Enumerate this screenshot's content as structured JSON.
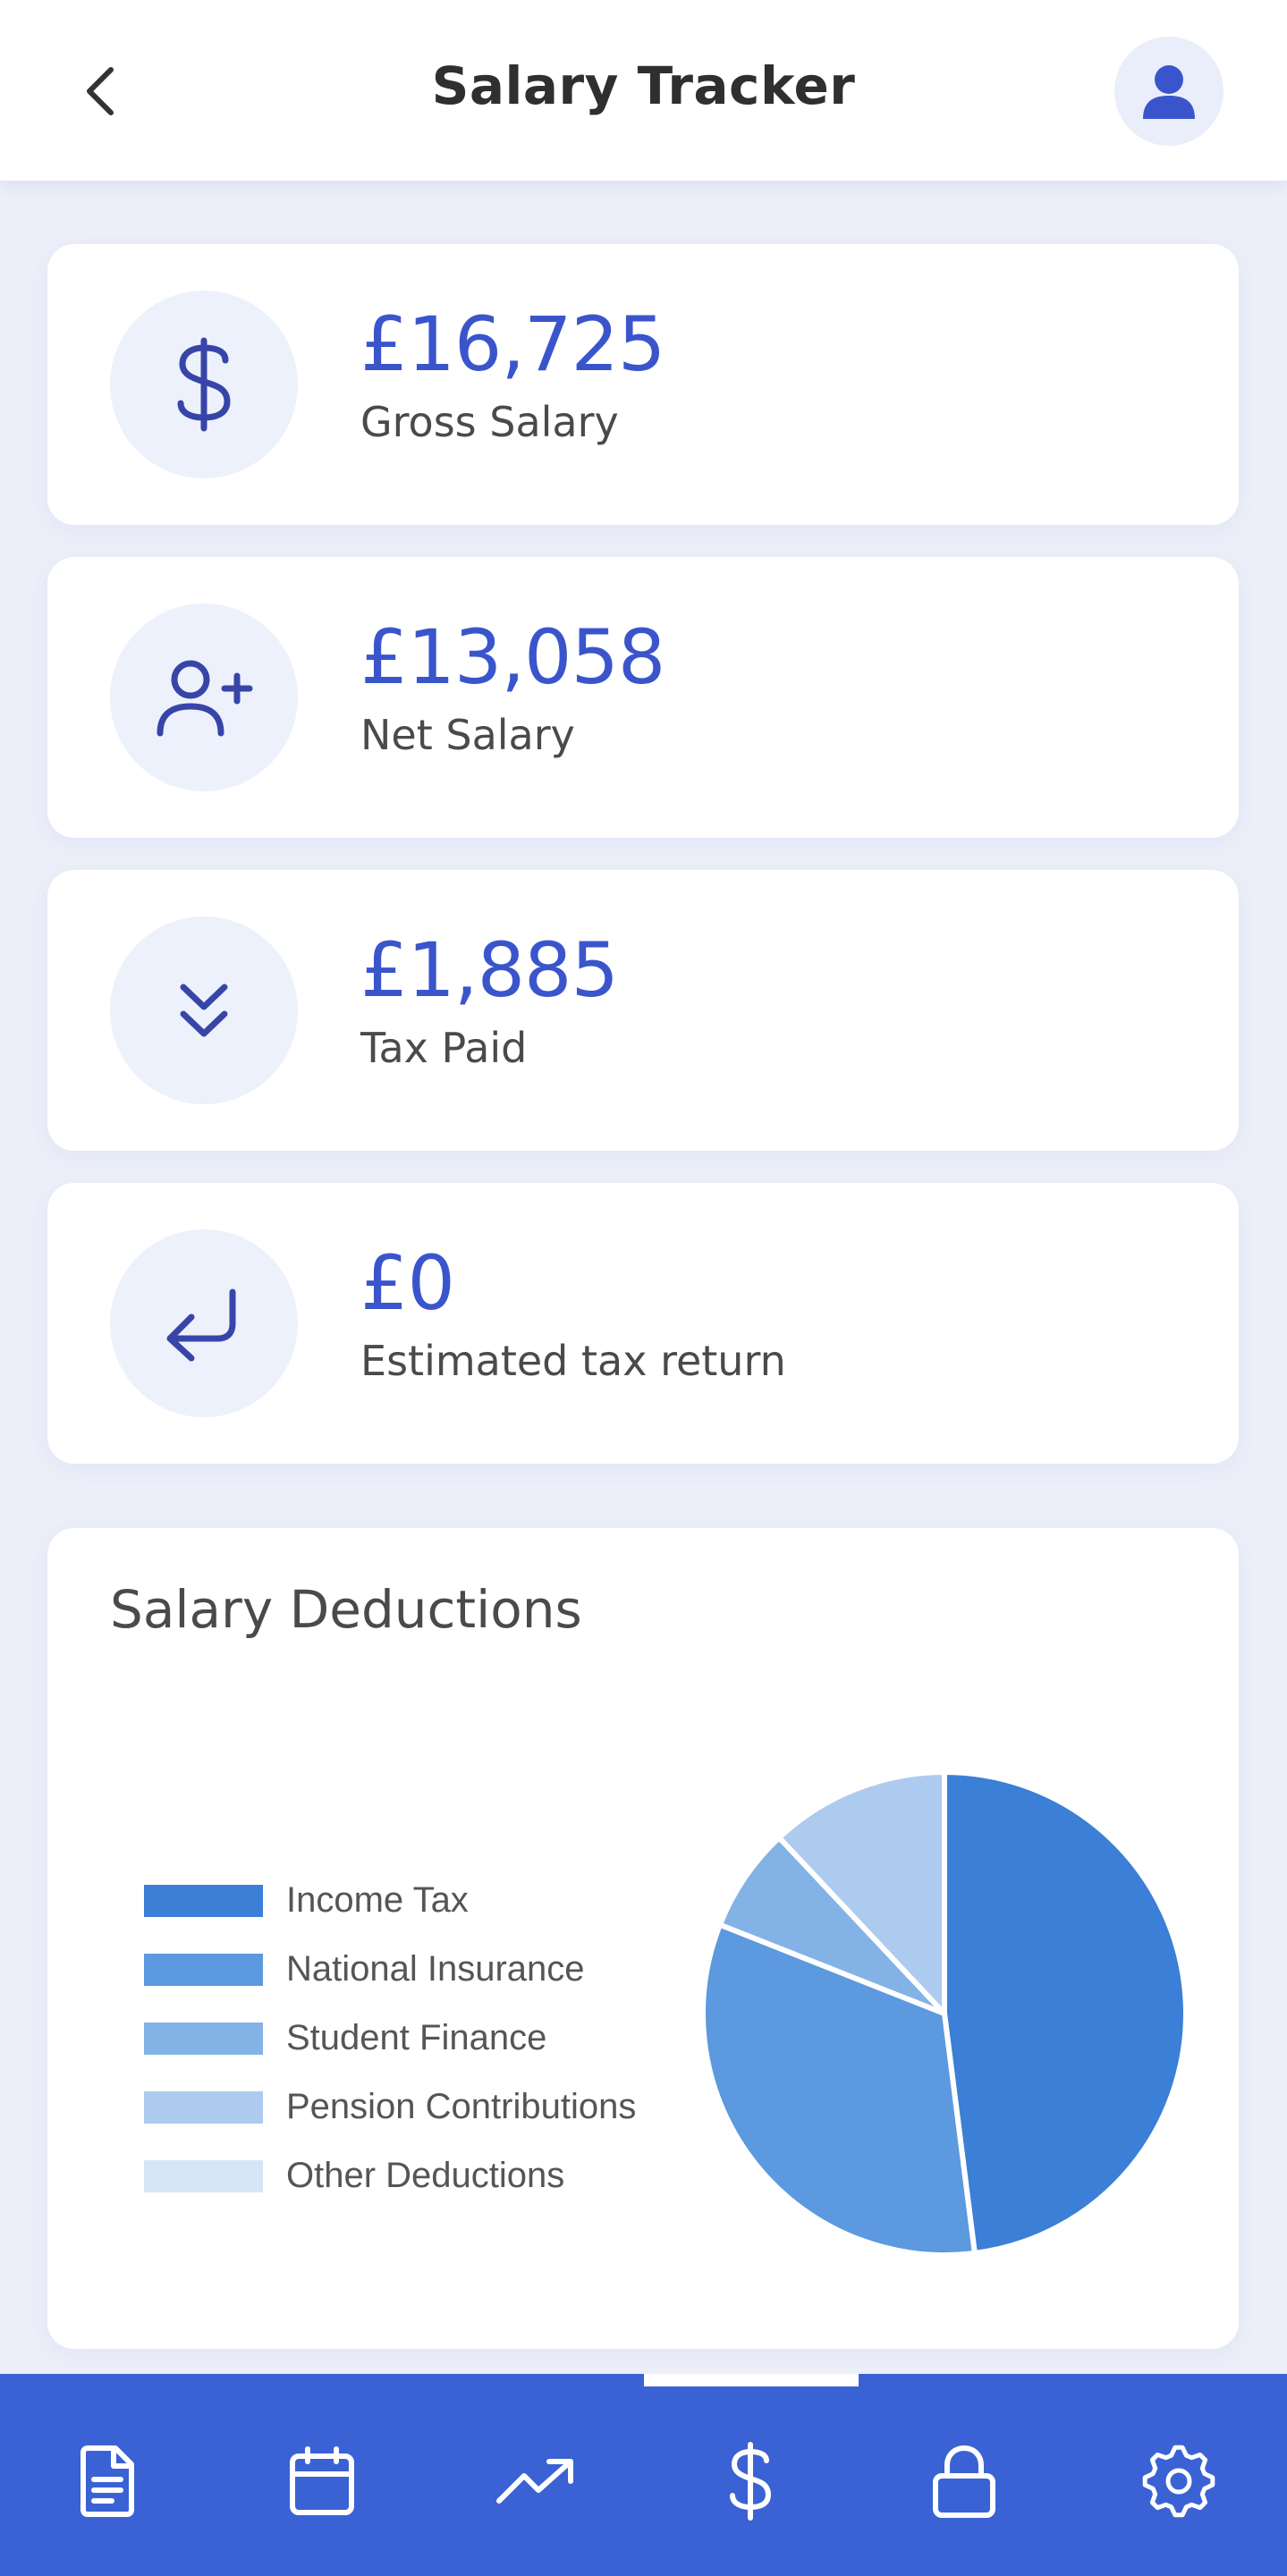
{
  "header": {
    "title": "Salary Tracker",
    "back_icon": "chevron-left-icon",
    "avatar_icon": "user-icon"
  },
  "stats": [
    {
      "icon": "dollar-icon",
      "value": "£16,725",
      "label": "Gross Salary"
    },
    {
      "icon": "user-plus-icon",
      "value": "£13,058",
      "label": "Net Salary"
    },
    {
      "icon": "chevrons-down-icon",
      "value": "£1,885",
      "label": "Tax Paid"
    },
    {
      "icon": "return-arrow-icon",
      "value": "£0",
      "label": "Estimated tax return"
    }
  ],
  "chart": {
    "title": "Salary Deductions"
  },
  "chart_data": {
    "type": "pie",
    "title": "Salary Deductions",
    "legend_position": "left",
    "categories": [
      "Income Tax",
      "National Insurance",
      "Student Finance",
      "Pension Contributions",
      "Other Deductions"
    ],
    "values": [
      48,
      33,
      7,
      12,
      0
    ],
    "colors": [
      "#3b7fd6",
      "#5c99de",
      "#82b2e6",
      "#adcbef",
      "#d6e6f7"
    ]
  },
  "nav": {
    "items": [
      {
        "icon": "document-icon",
        "label": "Documents"
      },
      {
        "icon": "calendar-icon",
        "label": "Calendar"
      },
      {
        "icon": "trending-up-icon",
        "label": "Trends"
      },
      {
        "icon": "dollar-icon",
        "label": "Salary"
      },
      {
        "icon": "lock-icon",
        "label": "Security"
      },
      {
        "icon": "gear-icon",
        "label": "Settings"
      }
    ],
    "active_index": 3
  },
  "colors": {
    "accent": "#3a55cc",
    "nav_background": "#3a62d4",
    "page_background": "#eceff9"
  }
}
